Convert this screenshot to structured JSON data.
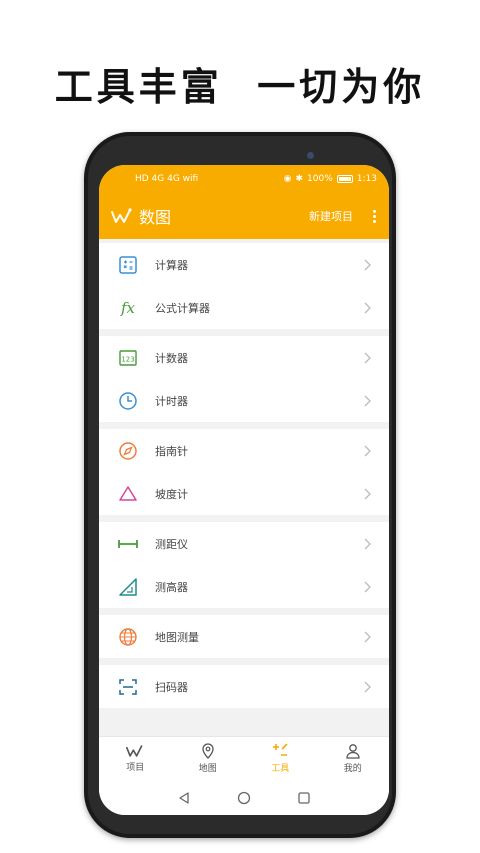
{
  "headline": "工具丰富  一切为你",
  "status": {
    "left_icons": "HD 4G 4G wifi",
    "percent": "100%",
    "time": "1:13"
  },
  "appbar": {
    "title": "数图",
    "new_project": "新建项目"
  },
  "groups": [
    {
      "items": [
        {
          "label": "计算器",
          "icon": "calculator-icon"
        },
        {
          "label": "公式计算器",
          "icon": "fx-icon"
        }
      ]
    },
    {
      "items": [
        {
          "label": "计数器",
          "icon": "counter-123-icon"
        },
        {
          "label": "计时器",
          "icon": "clock-icon"
        }
      ]
    },
    {
      "items": [
        {
          "label": "指南针",
          "icon": "compass-icon"
        },
        {
          "label": "坡度计",
          "icon": "triangle-icon"
        }
      ]
    },
    {
      "items": [
        {
          "label": "测距仪",
          "icon": "ruler-icon"
        },
        {
          "label": "测高器",
          "icon": "height-icon"
        }
      ]
    },
    {
      "items": [
        {
          "label": "地图测量",
          "icon": "globe-icon"
        }
      ]
    },
    {
      "items": [
        {
          "label": "扫码器",
          "icon": "scan-icon"
        }
      ]
    }
  ],
  "tabs": [
    {
      "label": "项目",
      "icon": "project-icon"
    },
    {
      "label": "地图",
      "icon": "map-pin-icon"
    },
    {
      "label": "工具",
      "icon": "tools-icon",
      "active": true
    },
    {
      "label": "我的",
      "icon": "user-icon"
    }
  ],
  "colors": {
    "accent": "#f8ac00",
    "blue": "#3a8fd6",
    "green": "#4a9a3a",
    "orange": "#f07c3a",
    "pink": "#d6459a",
    "teal": "#1e8a8a"
  }
}
